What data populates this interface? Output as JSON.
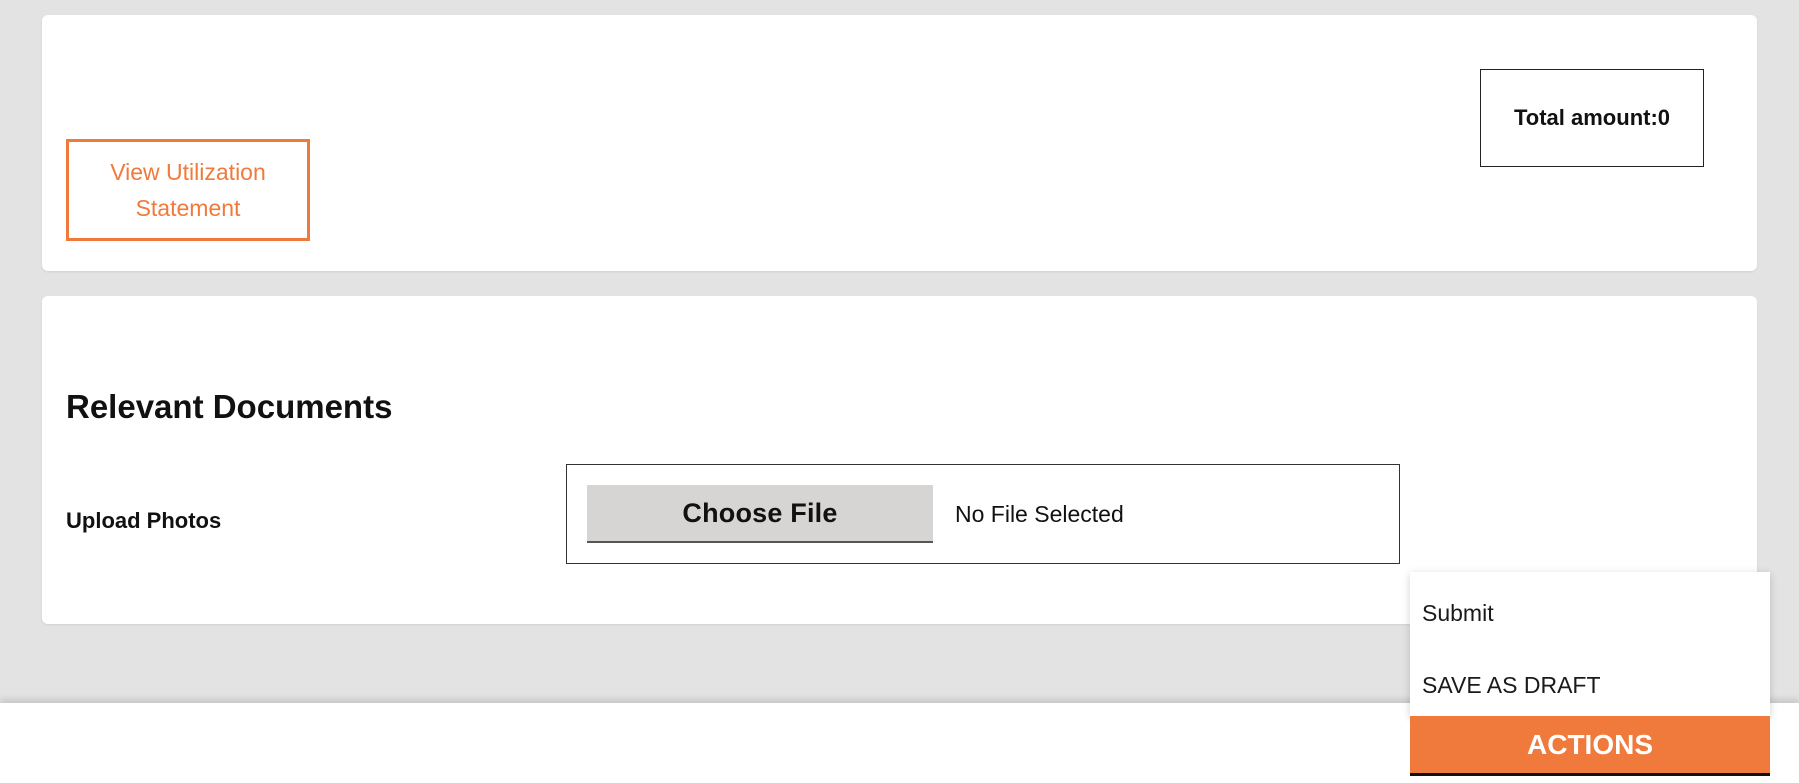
{
  "summary": {
    "view_utilization_label": "View Utilization Statement",
    "total_amount_text": "Total amount:0"
  },
  "documents": {
    "title": "Relevant Documents",
    "upload_photos_label": "Upload Photos",
    "choose_file_label": "Choose File",
    "file_status": "No File Selected"
  },
  "actions": {
    "menu_items": [
      {
        "label": "Submit"
      },
      {
        "label": "SAVE AS DRAFT"
      }
    ],
    "button_label": "ACTIONS"
  },
  "colors": {
    "accent": "#f07a3c",
    "background": "#e3e3e3",
    "card": "#ffffff",
    "file_button": "#d6d5d3"
  }
}
